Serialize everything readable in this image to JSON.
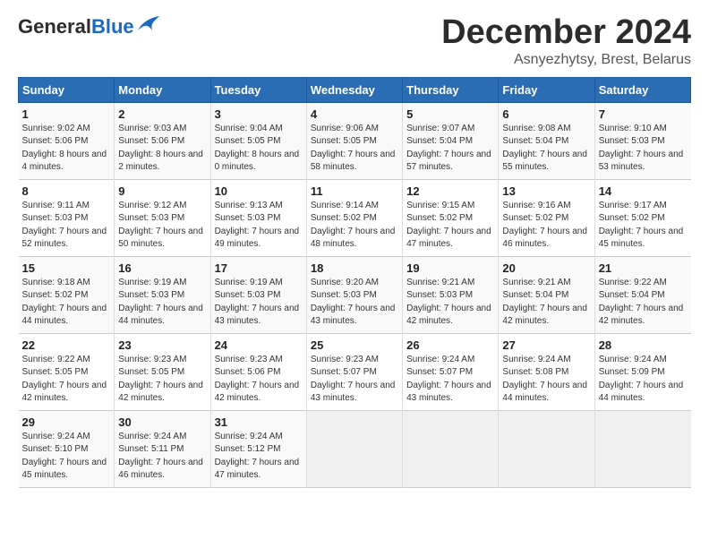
{
  "header": {
    "logo_general": "General",
    "logo_blue": "Blue",
    "month_title": "December 2024",
    "subtitle": "Asnyezhytsy, Brest, Belarus"
  },
  "days_of_week": [
    "Sunday",
    "Monday",
    "Tuesday",
    "Wednesday",
    "Thursday",
    "Friday",
    "Saturday"
  ],
  "weeks": [
    [
      {
        "day": "1",
        "sunrise": "Sunrise: 9:02 AM",
        "sunset": "Sunset: 5:06 PM",
        "daylight": "Daylight: 8 hours and 4 minutes."
      },
      {
        "day": "2",
        "sunrise": "Sunrise: 9:03 AM",
        "sunset": "Sunset: 5:06 PM",
        "daylight": "Daylight: 8 hours and 2 minutes."
      },
      {
        "day": "3",
        "sunrise": "Sunrise: 9:04 AM",
        "sunset": "Sunset: 5:05 PM",
        "daylight": "Daylight: 8 hours and 0 minutes."
      },
      {
        "day": "4",
        "sunrise": "Sunrise: 9:06 AM",
        "sunset": "Sunset: 5:05 PM",
        "daylight": "Daylight: 7 hours and 58 minutes."
      },
      {
        "day": "5",
        "sunrise": "Sunrise: 9:07 AM",
        "sunset": "Sunset: 5:04 PM",
        "daylight": "Daylight: 7 hours and 57 minutes."
      },
      {
        "day": "6",
        "sunrise": "Sunrise: 9:08 AM",
        "sunset": "Sunset: 5:04 PM",
        "daylight": "Daylight: 7 hours and 55 minutes."
      },
      {
        "day": "7",
        "sunrise": "Sunrise: 9:10 AM",
        "sunset": "Sunset: 5:03 PM",
        "daylight": "Daylight: 7 hours and 53 minutes."
      }
    ],
    [
      {
        "day": "8",
        "sunrise": "Sunrise: 9:11 AM",
        "sunset": "Sunset: 5:03 PM",
        "daylight": "Daylight: 7 hours and 52 minutes."
      },
      {
        "day": "9",
        "sunrise": "Sunrise: 9:12 AM",
        "sunset": "Sunset: 5:03 PM",
        "daylight": "Daylight: 7 hours and 50 minutes."
      },
      {
        "day": "10",
        "sunrise": "Sunrise: 9:13 AM",
        "sunset": "Sunset: 5:03 PM",
        "daylight": "Daylight: 7 hours and 49 minutes."
      },
      {
        "day": "11",
        "sunrise": "Sunrise: 9:14 AM",
        "sunset": "Sunset: 5:02 PM",
        "daylight": "Daylight: 7 hours and 48 minutes."
      },
      {
        "day": "12",
        "sunrise": "Sunrise: 9:15 AM",
        "sunset": "Sunset: 5:02 PM",
        "daylight": "Daylight: 7 hours and 47 minutes."
      },
      {
        "day": "13",
        "sunrise": "Sunrise: 9:16 AM",
        "sunset": "Sunset: 5:02 PM",
        "daylight": "Daylight: 7 hours and 46 minutes."
      },
      {
        "day": "14",
        "sunrise": "Sunrise: 9:17 AM",
        "sunset": "Sunset: 5:02 PM",
        "daylight": "Daylight: 7 hours and 45 minutes."
      }
    ],
    [
      {
        "day": "15",
        "sunrise": "Sunrise: 9:18 AM",
        "sunset": "Sunset: 5:02 PM",
        "daylight": "Daylight: 7 hours and 44 minutes."
      },
      {
        "day": "16",
        "sunrise": "Sunrise: 9:19 AM",
        "sunset": "Sunset: 5:03 PM",
        "daylight": "Daylight: 7 hours and 44 minutes."
      },
      {
        "day": "17",
        "sunrise": "Sunrise: 9:19 AM",
        "sunset": "Sunset: 5:03 PM",
        "daylight": "Daylight: 7 hours and 43 minutes."
      },
      {
        "day": "18",
        "sunrise": "Sunrise: 9:20 AM",
        "sunset": "Sunset: 5:03 PM",
        "daylight": "Daylight: 7 hours and 43 minutes."
      },
      {
        "day": "19",
        "sunrise": "Sunrise: 9:21 AM",
        "sunset": "Sunset: 5:03 PM",
        "daylight": "Daylight: 7 hours and 42 minutes."
      },
      {
        "day": "20",
        "sunrise": "Sunrise: 9:21 AM",
        "sunset": "Sunset: 5:04 PM",
        "daylight": "Daylight: 7 hours and 42 minutes."
      },
      {
        "day": "21",
        "sunrise": "Sunrise: 9:22 AM",
        "sunset": "Sunset: 5:04 PM",
        "daylight": "Daylight: 7 hours and 42 minutes."
      }
    ],
    [
      {
        "day": "22",
        "sunrise": "Sunrise: 9:22 AM",
        "sunset": "Sunset: 5:05 PM",
        "daylight": "Daylight: 7 hours and 42 minutes."
      },
      {
        "day": "23",
        "sunrise": "Sunrise: 9:23 AM",
        "sunset": "Sunset: 5:05 PM",
        "daylight": "Daylight: 7 hours and 42 minutes."
      },
      {
        "day": "24",
        "sunrise": "Sunrise: 9:23 AM",
        "sunset": "Sunset: 5:06 PM",
        "daylight": "Daylight: 7 hours and 42 minutes."
      },
      {
        "day": "25",
        "sunrise": "Sunrise: 9:23 AM",
        "sunset": "Sunset: 5:07 PM",
        "daylight": "Daylight: 7 hours and 43 minutes."
      },
      {
        "day": "26",
        "sunrise": "Sunrise: 9:24 AM",
        "sunset": "Sunset: 5:07 PM",
        "daylight": "Daylight: 7 hours and 43 minutes."
      },
      {
        "day": "27",
        "sunrise": "Sunrise: 9:24 AM",
        "sunset": "Sunset: 5:08 PM",
        "daylight": "Daylight: 7 hours and 44 minutes."
      },
      {
        "day": "28",
        "sunrise": "Sunrise: 9:24 AM",
        "sunset": "Sunset: 5:09 PM",
        "daylight": "Daylight: 7 hours and 44 minutes."
      }
    ],
    [
      {
        "day": "29",
        "sunrise": "Sunrise: 9:24 AM",
        "sunset": "Sunset: 5:10 PM",
        "daylight": "Daylight: 7 hours and 45 minutes."
      },
      {
        "day": "30",
        "sunrise": "Sunrise: 9:24 AM",
        "sunset": "Sunset: 5:11 PM",
        "daylight": "Daylight: 7 hours and 46 minutes."
      },
      {
        "day": "31",
        "sunrise": "Sunrise: 9:24 AM",
        "sunset": "Sunset: 5:12 PM",
        "daylight": "Daylight: 7 hours and 47 minutes."
      },
      null,
      null,
      null,
      null
    ]
  ]
}
